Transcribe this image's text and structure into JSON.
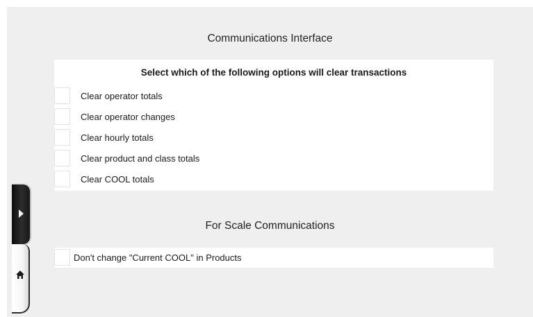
{
  "communications": {
    "title": "Communications Interface",
    "options_header": "Select which of the following options will clear transactions",
    "options": [
      {
        "label": "Clear operator totals",
        "checked": false
      },
      {
        "label": "Clear operator changes",
        "checked": false
      },
      {
        "label": "Clear hourly totals",
        "checked": false
      },
      {
        "label": "Clear product and class totals",
        "checked": false
      },
      {
        "label": "Clear COOL totals",
        "checked": false
      }
    ]
  },
  "scale": {
    "title": "For Scale Communications",
    "option": {
      "label": "Don't change \"Current COOL\" in Products",
      "checked": false
    }
  },
  "side_drawer": {
    "expand_icon": "triangle-right-icon",
    "home_icon": "home-icon"
  },
  "colors": {
    "panel_background": "#efefef",
    "card_background": "#ffffff",
    "checkbox_border": "#e2e2e2",
    "text": "#1a1a1a",
    "drawer_dark": "#1a1a1a"
  }
}
